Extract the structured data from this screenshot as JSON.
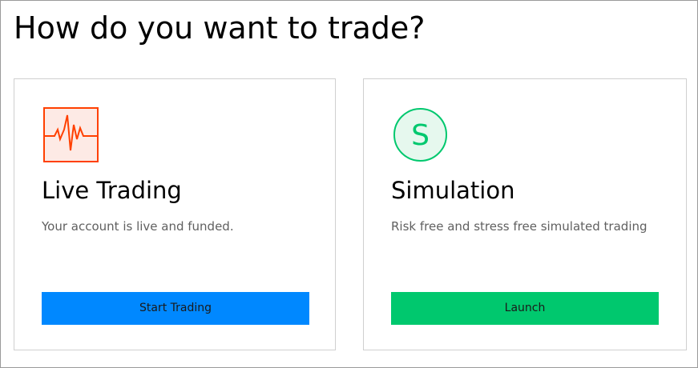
{
  "page": {
    "title": "How do you want to trade?"
  },
  "cards": {
    "live": {
      "icon": "pulse-chart-icon",
      "title": "Live Trading",
      "description": "Your account is live and funded.",
      "button_label": "Start Trading",
      "accent_color": "#0088ff",
      "icon_color": "#ff4000"
    },
    "simulation": {
      "icon": "simulation-s-icon",
      "icon_letter": "S",
      "title": "Simulation",
      "description": "Risk free and stress free simulated trading",
      "button_label": "Launch",
      "accent_color": "#00c86e",
      "icon_color": "#00c86e"
    }
  }
}
